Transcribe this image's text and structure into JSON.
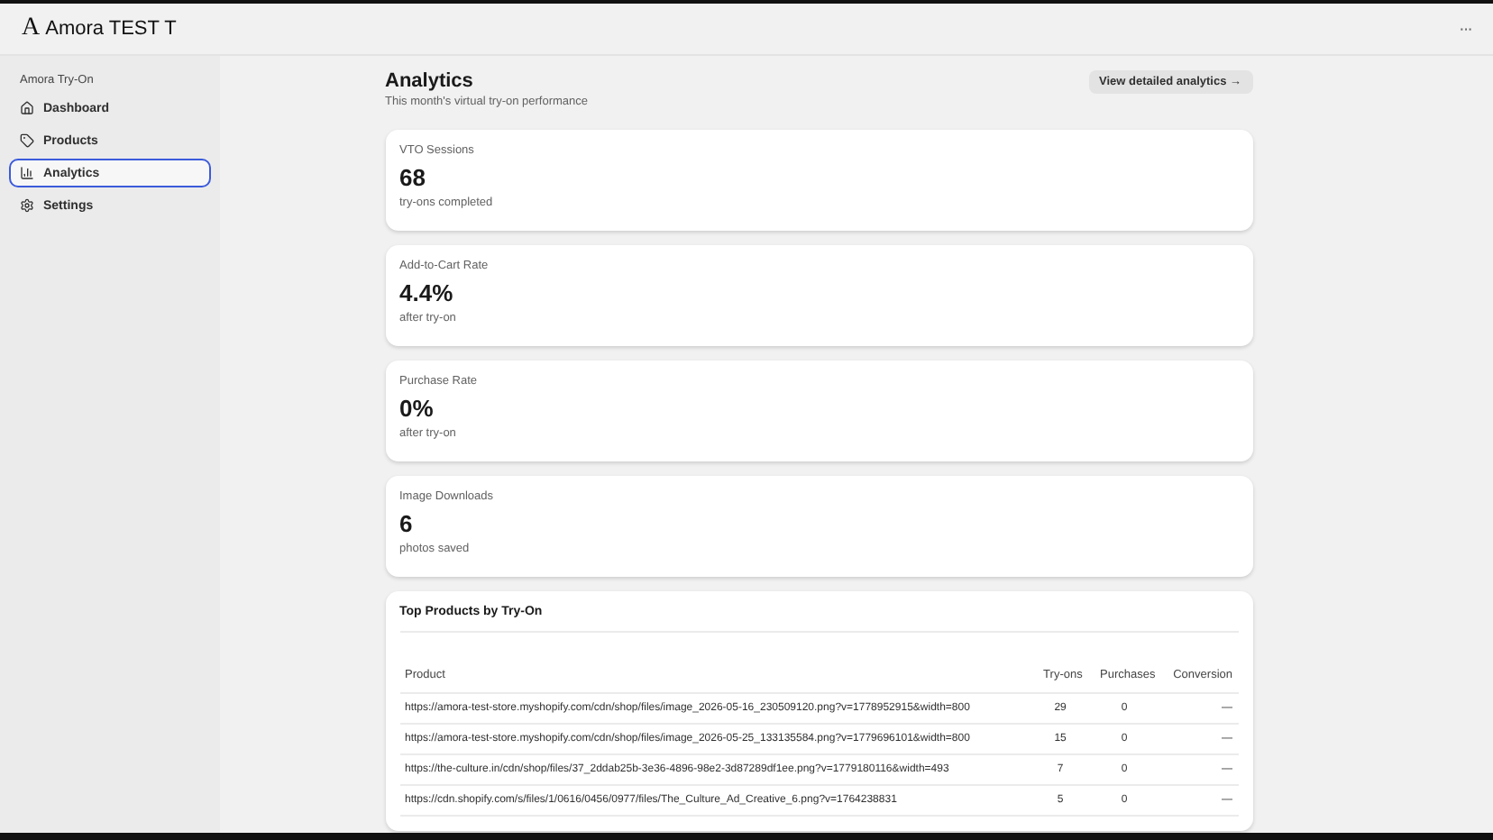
{
  "app": {
    "title": "Amora TEST T",
    "logo": "A",
    "more": "···"
  },
  "sidebar": {
    "heading": "Amora Try-On",
    "items": [
      {
        "label": "Dashboard",
        "selected": false
      },
      {
        "label": "Products",
        "selected": false
      },
      {
        "label": "Analytics",
        "selected": true
      },
      {
        "label": "Settings",
        "selected": false
      }
    ]
  },
  "page": {
    "title": "Analytics",
    "subtitle": "This month's virtual try-on performance",
    "action": "View detailed analytics →"
  },
  "metrics": [
    {
      "label": "VTO Sessions",
      "value": "68",
      "caption": "try-ons completed"
    },
    {
      "label": "Add-to-Cart Rate",
      "value": "4.4%",
      "caption": "after try-on"
    },
    {
      "label": "Purchase Rate",
      "value": "0%",
      "caption": "after try-on"
    },
    {
      "label": "Image Downloads",
      "value": "6",
      "caption": "photos saved"
    }
  ],
  "top_products": {
    "title": "Top Products by Try-On",
    "columns": [
      "Product",
      "Try-ons",
      "Purchases",
      "Conversion"
    ],
    "rows": [
      [
        "https://amora-test-store.myshopify.com/cdn/shop/files/image_2026-05-16_230509120.png?v=1778952915&width=800",
        "29",
        "0",
        "—"
      ],
      [
        "https://amora-test-store.myshopify.com/cdn/shop/files/image_2026-05-25_133135584.png?v=1779696101&width=800",
        "15",
        "0",
        "—"
      ],
      [
        "https://the-culture.in/cdn/shop/files/37_2ddab25b-3e36-4896-98e2-3d87289df1ee.png?v=1779180116&width=493",
        "7",
        "0",
        "—"
      ],
      [
        "https://cdn.shopify.com/s/files/1/0616/0456/0977/files/The_Culture_Ad_Creative_6.png?v=1764238831",
        "5",
        "0",
        "—"
      ]
    ]
  }
}
